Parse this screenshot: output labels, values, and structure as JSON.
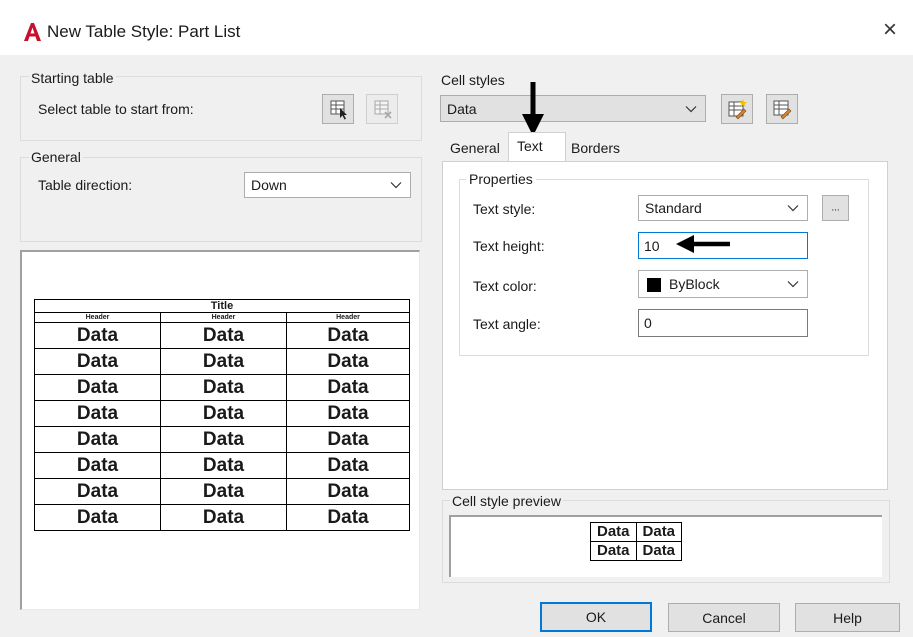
{
  "window": {
    "title": "New Table Style: Part List",
    "close_glyph": "×"
  },
  "starting_table": {
    "legend": "Starting table",
    "select_label": "Select table to start from:"
  },
  "general": {
    "legend": "General",
    "direction_label": "Table direction:",
    "direction_value": "Down"
  },
  "preview_table": {
    "title": "Title",
    "headers": [
      "Header",
      "Header",
      "Header"
    ],
    "rows": [
      [
        "Data",
        "Data",
        "Data"
      ],
      [
        "Data",
        "Data",
        "Data"
      ],
      [
        "Data",
        "Data",
        "Data"
      ],
      [
        "Data",
        "Data",
        "Data"
      ],
      [
        "Data",
        "Data",
        "Data"
      ],
      [
        "Data",
        "Data",
        "Data"
      ],
      [
        "Data",
        "Data",
        "Data"
      ],
      [
        "Data",
        "Data",
        "Data"
      ]
    ]
  },
  "cell_styles": {
    "legend": "Cell styles",
    "selected": "Data",
    "tabs": [
      "General",
      "Text",
      "Borders"
    ],
    "active_tab": "Text"
  },
  "properties": {
    "legend": "Properties",
    "text_style_label": "Text style:",
    "text_style_value": "Standard",
    "browse_label": "...",
    "text_height_label": "Text height:",
    "text_height_value": "10",
    "text_color_label": "Text color:",
    "text_color_value": "ByBlock",
    "text_color_swatch": "#000000",
    "text_angle_label": "Text angle:",
    "text_angle_value": "0"
  },
  "cell_style_preview": {
    "legend": "Cell style preview",
    "cells": [
      [
        "Data",
        "Data"
      ],
      [
        "Data",
        "Data"
      ]
    ]
  },
  "buttons": {
    "ok": "OK",
    "cancel": "Cancel",
    "help": "Help"
  },
  "colors": {
    "accent": "#0078d7",
    "app_icon": "#c8102e"
  }
}
